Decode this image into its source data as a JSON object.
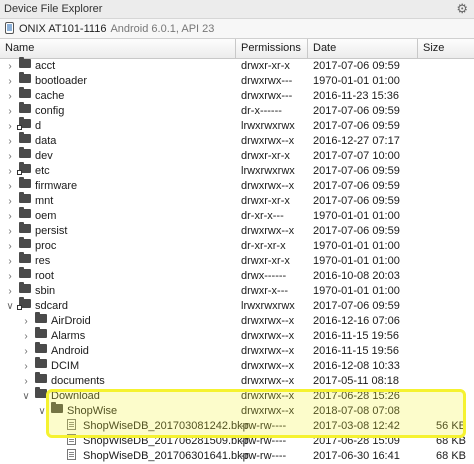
{
  "window": {
    "title": "Device File Explorer",
    "settings_icon": "gear-icon"
  },
  "device": {
    "name": "ONIX AT101-1116",
    "detail": "Android 6.0.1, API 23"
  },
  "columns": {
    "name": "Name",
    "permissions": "Permissions",
    "date": "Date",
    "size": "Size"
  },
  "rows": [
    {
      "name": "acct",
      "perm": "drwxr-xr-x",
      "date": "2017-07-06 09:59",
      "size": "",
      "depth": 0,
      "type": "folder",
      "exp": "collapsed"
    },
    {
      "name": "bootloader",
      "perm": "drwxrwx---",
      "date": "1970-01-01 01:00",
      "size": "",
      "depth": 0,
      "type": "folder",
      "exp": "collapsed"
    },
    {
      "name": "cache",
      "perm": "drwxrwx---",
      "date": "2016-11-23 15:36",
      "size": "",
      "depth": 0,
      "type": "folder",
      "exp": "collapsed"
    },
    {
      "name": "config",
      "perm": "dr-x------",
      "date": "2017-07-06 09:59",
      "size": "",
      "depth": 0,
      "type": "folder",
      "exp": "collapsed"
    },
    {
      "name": "d",
      "perm": "lrwxrwxrwx",
      "date": "2017-07-06 09:59",
      "size": "",
      "depth": 0,
      "type": "link",
      "exp": "collapsed"
    },
    {
      "name": "data",
      "perm": "drwxrwx--x",
      "date": "2016-12-27 07:17",
      "size": "",
      "depth": 0,
      "type": "folder",
      "exp": "collapsed"
    },
    {
      "name": "dev",
      "perm": "drwxr-xr-x",
      "date": "2017-07-07 10:00",
      "size": "",
      "depth": 0,
      "type": "folder",
      "exp": "collapsed"
    },
    {
      "name": "etc",
      "perm": "lrwxrwxrwx",
      "date": "2017-07-06 09:59",
      "size": "",
      "depth": 0,
      "type": "link",
      "exp": "collapsed"
    },
    {
      "name": "firmware",
      "perm": "drwxrwx--x",
      "date": "2017-07-06 09:59",
      "size": "",
      "depth": 0,
      "type": "folder",
      "exp": "collapsed"
    },
    {
      "name": "mnt",
      "perm": "drwxr-xr-x",
      "date": "2017-07-06 09:59",
      "size": "",
      "depth": 0,
      "type": "folder",
      "exp": "collapsed"
    },
    {
      "name": "oem",
      "perm": "dr-xr-x---",
      "date": "1970-01-01 01:00",
      "size": "",
      "depth": 0,
      "type": "folder",
      "exp": "collapsed"
    },
    {
      "name": "persist",
      "perm": "drwxrwx--x",
      "date": "2017-07-06 09:59",
      "size": "",
      "depth": 0,
      "type": "folder",
      "exp": "collapsed"
    },
    {
      "name": "proc",
      "perm": "dr-xr-xr-x",
      "date": "1970-01-01 01:00",
      "size": "",
      "depth": 0,
      "type": "folder",
      "exp": "collapsed"
    },
    {
      "name": "res",
      "perm": "drwxr-xr-x",
      "date": "1970-01-01 01:00",
      "size": "",
      "depth": 0,
      "type": "folder",
      "exp": "collapsed"
    },
    {
      "name": "root",
      "perm": "drwx------",
      "date": "2016-10-08 20:03",
      "size": "",
      "depth": 0,
      "type": "folder",
      "exp": "collapsed"
    },
    {
      "name": "sbin",
      "perm": "drwxr-x---",
      "date": "1970-01-01 01:00",
      "size": "",
      "depth": 0,
      "type": "folder",
      "exp": "collapsed"
    },
    {
      "name": "sdcard",
      "perm": "lrwxrwxrwx",
      "date": "2017-07-06 09:59",
      "size": "",
      "depth": 0,
      "type": "link",
      "exp": "expanded"
    },
    {
      "name": "AirDroid",
      "perm": "drwxrwx--x",
      "date": "2016-12-16 07:06",
      "size": "",
      "depth": 1,
      "type": "folder",
      "exp": "collapsed"
    },
    {
      "name": "Alarms",
      "perm": "drwxrwx--x",
      "date": "2016-11-15 19:56",
      "size": "",
      "depth": 1,
      "type": "folder",
      "exp": "collapsed"
    },
    {
      "name": "Android",
      "perm": "drwxrwx--x",
      "date": "2016-11-15 19:56",
      "size": "",
      "depth": 1,
      "type": "folder",
      "exp": "collapsed"
    },
    {
      "name": "DCIM",
      "perm": "drwxrwx--x",
      "date": "2016-12-08 10:33",
      "size": "",
      "depth": 1,
      "type": "folder",
      "exp": "collapsed"
    },
    {
      "name": "documents",
      "perm": "drwxrwx--x",
      "date": "2017-05-11 08:18",
      "size": "",
      "depth": 1,
      "type": "folder",
      "exp": "collapsed"
    },
    {
      "name": "Download",
      "perm": "drwxrwx--x",
      "date": "2017-06-28 15:26",
      "size": "",
      "depth": 1,
      "type": "folder",
      "exp": "expanded"
    },
    {
      "name": "ShopWise",
      "perm": "drwxrwx--x",
      "date": "2018-07-08 07:08",
      "size": "",
      "depth": 2,
      "type": "folder",
      "exp": "expanded"
    },
    {
      "name": "ShopWiseDB_201703081242.bkp",
      "perm": "-rw-rw----",
      "date": "2017-03-08 12:42",
      "size": "56 KB",
      "depth": 3,
      "type": "file",
      "exp": "none"
    },
    {
      "name": "ShopWiseDB_201706281509.bkp",
      "perm": "-rw-rw----",
      "date": "2017-06-28 15:09",
      "size": "68 KB",
      "depth": 3,
      "type": "file",
      "exp": "none"
    },
    {
      "name": "ShopWiseDB_201706301641.bkp",
      "perm": "-rw-rw----",
      "date": "2017-06-30 16:41",
      "size": "68 KB",
      "depth": 3,
      "type": "file",
      "exp": "none"
    }
  ]
}
